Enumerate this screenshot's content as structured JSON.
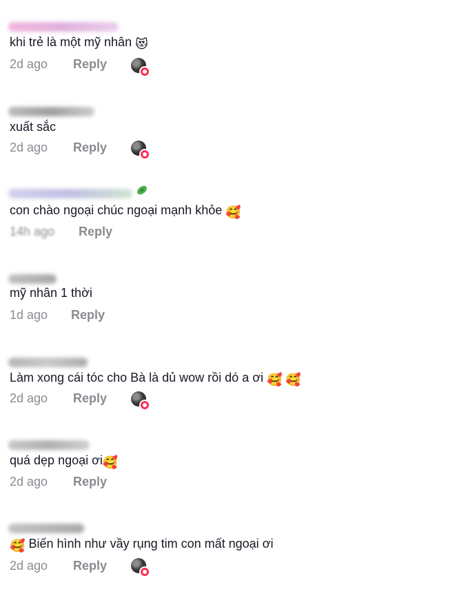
{
  "comments": [
    {
      "text": "khi trẻ là một mỹ nhân",
      "emoji": "😻",
      "time": "2d ago",
      "reply": "Reply",
      "author_liked": true
    },
    {
      "text": "xuất sắc",
      "emoji": "",
      "time": "2d ago",
      "reply": "Reply",
      "author_liked": true
    },
    {
      "text": "con chào ngoại chúc ngoại mạnh khỏe",
      "emoji": "🥰",
      "time": "14h ago",
      "reply": "Reply",
      "author_liked": false
    },
    {
      "text": "mỹ nhân 1 thời",
      "emoji": "",
      "time": "1d ago",
      "reply": "Reply",
      "author_liked": false
    },
    {
      "text": "Làm xong cái tóc cho Bà là dủ wow rồi dó a ơi",
      "emoji": "🥰 🥰",
      "time": "2d ago",
      "reply": "Reply",
      "author_liked": true
    },
    {
      "text": "quá dẹp ngoại ơi",
      "emoji": "🥰",
      "time": "2d ago",
      "reply": "Reply",
      "author_liked": false
    },
    {
      "text": "Biến hình như vầy rụng tim con mất ngoại ơi",
      "emoji_prefix": "🥰",
      "time": "2d ago",
      "reply": "Reply",
      "author_liked": true
    }
  ],
  "icons": {
    "author_like": "author-liked-avatar-icon",
    "heart": "heart-icon"
  },
  "colors": {
    "text": "#161823",
    "meta": "#8a8b91",
    "heart": "#fe2c55"
  }
}
